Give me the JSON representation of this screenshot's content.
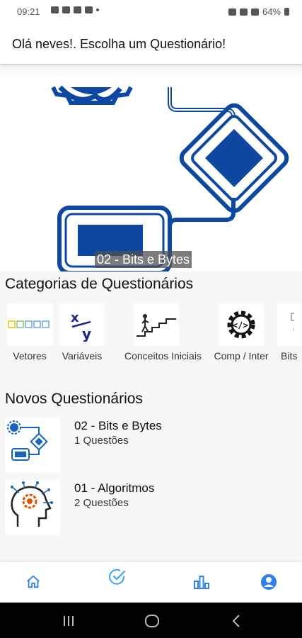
{
  "status_bar": {
    "time": "09:21",
    "battery": "64%"
  },
  "header": {
    "greeting": "Olá neves!. Escolha um Questionário!"
  },
  "banner": {
    "caption": "02 - Bits e Bytes"
  },
  "categories": {
    "title": "Categorias de Questionários",
    "items": [
      {
        "label": "Vetores"
      },
      {
        "label": "Variáveis"
      },
      {
        "label": "Conceitos Iniciais"
      },
      {
        "label": "Comp / Inter"
      },
      {
        "label": "Bits"
      }
    ]
  },
  "new_quizzes": {
    "title": "Novos Questionários",
    "items": [
      {
        "name": "02 - Bits e Bytes",
        "count": "1 Questões"
      },
      {
        "name": "01 - Algoritmos",
        "count": "2 Questões"
      }
    ]
  },
  "bottom_nav": {
    "items": [
      {
        "icon": "home-icon"
      },
      {
        "icon": "check-circle-icon"
      },
      {
        "icon": "bar-chart-icon"
      },
      {
        "icon": "account-icon"
      }
    ]
  },
  "colors": {
    "accent": "#2f80ed",
    "brand_blue": "#0d47a1",
    "nav_active": "#3aa0ff"
  }
}
